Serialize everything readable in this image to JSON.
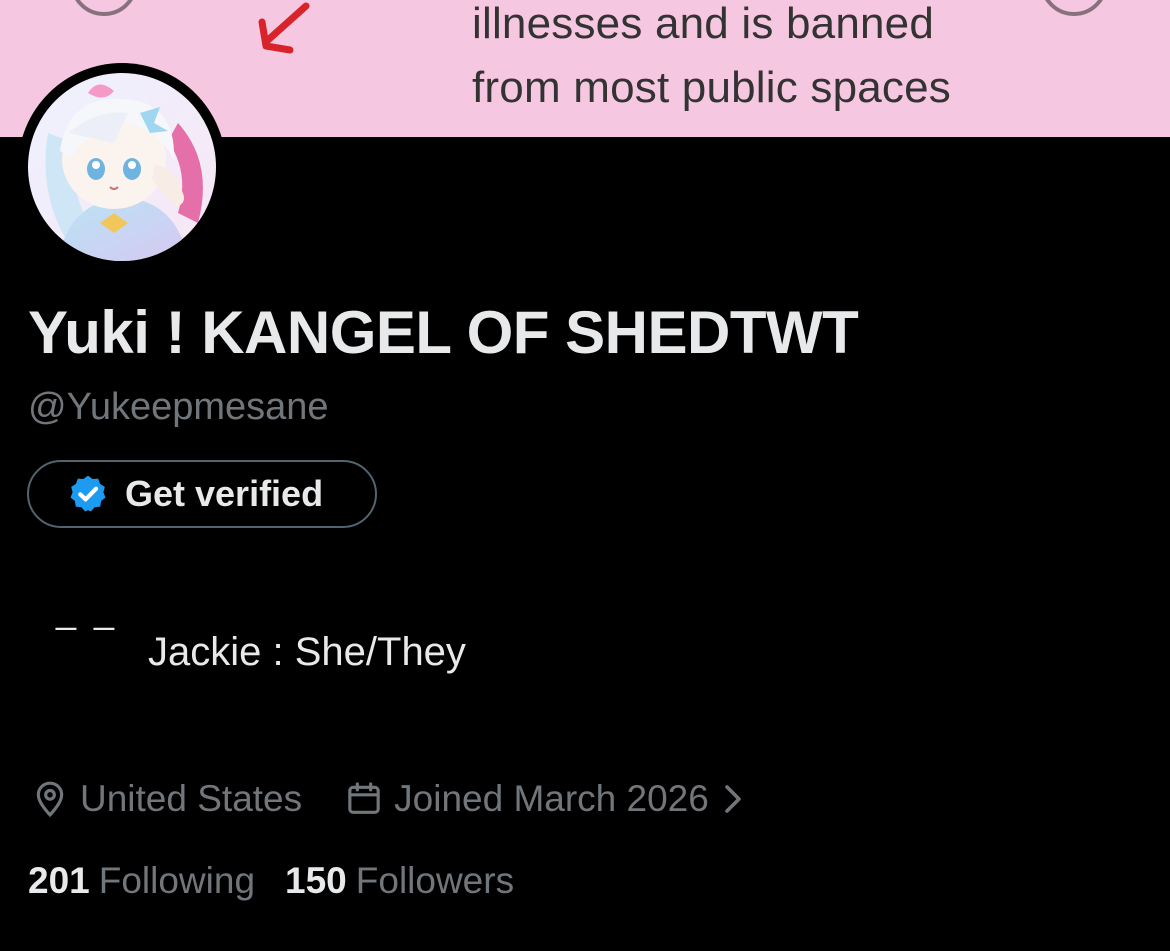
{
  "banner": {
    "lines": [
      "illnesses and is banned",
      "from most public spaces"
    ],
    "background": "#f6c7e1"
  },
  "profile": {
    "display_name": "Yuki ! KANGEL OF SHEDTWT",
    "handle": "@Yukeepmesane",
    "avatar_icon": "avatar-anime-icon"
  },
  "verify_button": {
    "label": "Get verified",
    "icon": "verified-badge-icon",
    "badge_color": "#1d9bf0"
  },
  "bio": {
    "dash": "_ _",
    "line": "Jackie : She/They"
  },
  "meta": {
    "location": "United States",
    "location_icon": "location-pin-icon",
    "joined": "Joined March 2026",
    "joined_icon": "calendar-icon",
    "chevron_icon": "chevron-right-icon"
  },
  "counts": {
    "following_count": "201",
    "following_label": "Following",
    "followers_count": "150",
    "followers_label": "Followers"
  },
  "colors": {
    "background": "#000000",
    "primary_text": "#e7e9ea",
    "secondary_text": "#71767b",
    "border": "#536471",
    "accent": "#1d9bf0"
  }
}
